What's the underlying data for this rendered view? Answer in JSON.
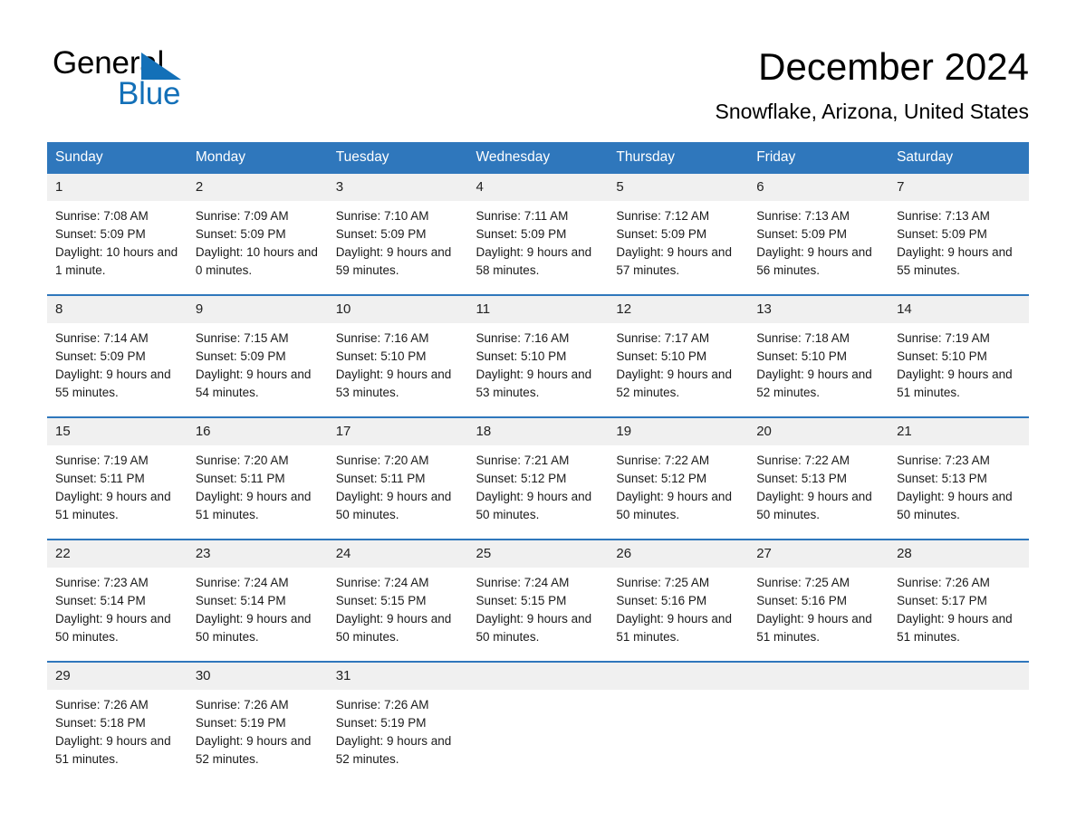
{
  "brand": {
    "name_part1": "General",
    "name_part2": "Blue",
    "accent_color": "#1370b8"
  },
  "header": {
    "title": "December 2024",
    "subtitle": "Snowflake, Arizona, United States"
  },
  "theme": {
    "header_blue": "#2f77bc",
    "daynum_band": "#f0f0f0",
    "text": "#000000"
  },
  "weekday_headers": [
    "Sunday",
    "Monday",
    "Tuesday",
    "Wednesday",
    "Thursday",
    "Friday",
    "Saturday"
  ],
  "labels": {
    "sunrise_prefix": "Sunrise:",
    "sunset_prefix": "Sunset:",
    "daylight_prefix": "Daylight:"
  },
  "weeks": [
    [
      {
        "day": "1",
        "sunrise": "Sunrise: 7:08 AM",
        "sunset": "Sunset: 5:09 PM",
        "daylight": "Daylight: 10 hours and 1 minute."
      },
      {
        "day": "2",
        "sunrise": "Sunrise: 7:09 AM",
        "sunset": "Sunset: 5:09 PM",
        "daylight": "Daylight: 10 hours and 0 minutes."
      },
      {
        "day": "3",
        "sunrise": "Sunrise: 7:10 AM",
        "sunset": "Sunset: 5:09 PM",
        "daylight": "Daylight: 9 hours and 59 minutes."
      },
      {
        "day": "4",
        "sunrise": "Sunrise: 7:11 AM",
        "sunset": "Sunset: 5:09 PM",
        "daylight": "Daylight: 9 hours and 58 minutes."
      },
      {
        "day": "5",
        "sunrise": "Sunrise: 7:12 AM",
        "sunset": "Sunset: 5:09 PM",
        "daylight": "Daylight: 9 hours and 57 minutes."
      },
      {
        "day": "6",
        "sunrise": "Sunrise: 7:13 AM",
        "sunset": "Sunset: 5:09 PM",
        "daylight": "Daylight: 9 hours and 56 minutes."
      },
      {
        "day": "7",
        "sunrise": "Sunrise: 7:13 AM",
        "sunset": "Sunset: 5:09 PM",
        "daylight": "Daylight: 9 hours and 55 minutes."
      }
    ],
    [
      {
        "day": "8",
        "sunrise": "Sunrise: 7:14 AM",
        "sunset": "Sunset: 5:09 PM",
        "daylight": "Daylight: 9 hours and 55 minutes."
      },
      {
        "day": "9",
        "sunrise": "Sunrise: 7:15 AM",
        "sunset": "Sunset: 5:09 PM",
        "daylight": "Daylight: 9 hours and 54 minutes."
      },
      {
        "day": "10",
        "sunrise": "Sunrise: 7:16 AM",
        "sunset": "Sunset: 5:10 PM",
        "daylight": "Daylight: 9 hours and 53 minutes."
      },
      {
        "day": "11",
        "sunrise": "Sunrise: 7:16 AM",
        "sunset": "Sunset: 5:10 PM",
        "daylight": "Daylight: 9 hours and 53 minutes."
      },
      {
        "day": "12",
        "sunrise": "Sunrise: 7:17 AM",
        "sunset": "Sunset: 5:10 PM",
        "daylight": "Daylight: 9 hours and 52 minutes."
      },
      {
        "day": "13",
        "sunrise": "Sunrise: 7:18 AM",
        "sunset": "Sunset: 5:10 PM",
        "daylight": "Daylight: 9 hours and 52 minutes."
      },
      {
        "day": "14",
        "sunrise": "Sunrise: 7:19 AM",
        "sunset": "Sunset: 5:10 PM",
        "daylight": "Daylight: 9 hours and 51 minutes."
      }
    ],
    [
      {
        "day": "15",
        "sunrise": "Sunrise: 7:19 AM",
        "sunset": "Sunset: 5:11 PM",
        "daylight": "Daylight: 9 hours and 51 minutes."
      },
      {
        "day": "16",
        "sunrise": "Sunrise: 7:20 AM",
        "sunset": "Sunset: 5:11 PM",
        "daylight": "Daylight: 9 hours and 51 minutes."
      },
      {
        "day": "17",
        "sunrise": "Sunrise: 7:20 AM",
        "sunset": "Sunset: 5:11 PM",
        "daylight": "Daylight: 9 hours and 50 minutes."
      },
      {
        "day": "18",
        "sunrise": "Sunrise: 7:21 AM",
        "sunset": "Sunset: 5:12 PM",
        "daylight": "Daylight: 9 hours and 50 minutes."
      },
      {
        "day": "19",
        "sunrise": "Sunrise: 7:22 AM",
        "sunset": "Sunset: 5:12 PM",
        "daylight": "Daylight: 9 hours and 50 minutes."
      },
      {
        "day": "20",
        "sunrise": "Sunrise: 7:22 AM",
        "sunset": "Sunset: 5:13 PM",
        "daylight": "Daylight: 9 hours and 50 minutes."
      },
      {
        "day": "21",
        "sunrise": "Sunrise: 7:23 AM",
        "sunset": "Sunset: 5:13 PM",
        "daylight": "Daylight: 9 hours and 50 minutes."
      }
    ],
    [
      {
        "day": "22",
        "sunrise": "Sunrise: 7:23 AM",
        "sunset": "Sunset: 5:14 PM",
        "daylight": "Daylight: 9 hours and 50 minutes."
      },
      {
        "day": "23",
        "sunrise": "Sunrise: 7:24 AM",
        "sunset": "Sunset: 5:14 PM",
        "daylight": "Daylight: 9 hours and 50 minutes."
      },
      {
        "day": "24",
        "sunrise": "Sunrise: 7:24 AM",
        "sunset": "Sunset: 5:15 PM",
        "daylight": "Daylight: 9 hours and 50 minutes."
      },
      {
        "day": "25",
        "sunrise": "Sunrise: 7:24 AM",
        "sunset": "Sunset: 5:15 PM",
        "daylight": "Daylight: 9 hours and 50 minutes."
      },
      {
        "day": "26",
        "sunrise": "Sunrise: 7:25 AM",
        "sunset": "Sunset: 5:16 PM",
        "daylight": "Daylight: 9 hours and 51 minutes."
      },
      {
        "day": "27",
        "sunrise": "Sunrise: 7:25 AM",
        "sunset": "Sunset: 5:16 PM",
        "daylight": "Daylight: 9 hours and 51 minutes."
      },
      {
        "day": "28",
        "sunrise": "Sunrise: 7:26 AM",
        "sunset": "Sunset: 5:17 PM",
        "daylight": "Daylight: 9 hours and 51 minutes."
      }
    ],
    [
      {
        "day": "29",
        "sunrise": "Sunrise: 7:26 AM",
        "sunset": "Sunset: 5:18 PM",
        "daylight": "Daylight: 9 hours and 51 minutes."
      },
      {
        "day": "30",
        "sunrise": "Sunrise: 7:26 AM",
        "sunset": "Sunset: 5:19 PM",
        "daylight": "Daylight: 9 hours and 52 minutes."
      },
      {
        "day": "31",
        "sunrise": "Sunrise: 7:26 AM",
        "sunset": "Sunset: 5:19 PM",
        "daylight": "Daylight: 9 hours and 52 minutes."
      },
      {
        "day": "",
        "sunrise": "",
        "sunset": "",
        "daylight": ""
      },
      {
        "day": "",
        "sunrise": "",
        "sunset": "",
        "daylight": ""
      },
      {
        "day": "",
        "sunrise": "",
        "sunset": "",
        "daylight": ""
      },
      {
        "day": "",
        "sunrise": "",
        "sunset": "",
        "daylight": ""
      }
    ]
  ]
}
